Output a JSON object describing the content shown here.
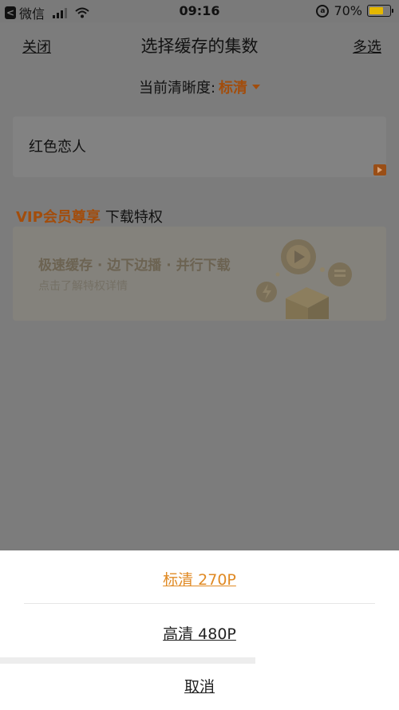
{
  "status_bar": {
    "app": "微信",
    "time": "09:16",
    "battery": "70%",
    "battery_level": 0.7,
    "battery_color": "#e5b800"
  },
  "nav": {
    "close": "关闭",
    "title": "选择缓存的集数",
    "multi_select": "多选"
  },
  "quality": {
    "label": "当前清晰度:",
    "value": "标清",
    "accent": "#a24d0c"
  },
  "episode": {
    "name": "红色恋人"
  },
  "vip": {
    "highlight": "VIP会员尊享",
    "text": "下载特权"
  },
  "banner": {
    "headline": "极速缓存 · 边下边播 · 并行下载",
    "sub": "点击了解特权详情"
  },
  "sheet": {
    "options": [
      "标清 270P",
      "高清 480P"
    ],
    "cancel": "取消",
    "selected_color": "#e08a24"
  },
  "icons": [
    "back-icon",
    "signal-icon",
    "wifi-icon",
    "rotation-lock-icon",
    "battery-icon",
    "caret-down-icon",
    "play-icon",
    "gift-box-icon"
  ]
}
